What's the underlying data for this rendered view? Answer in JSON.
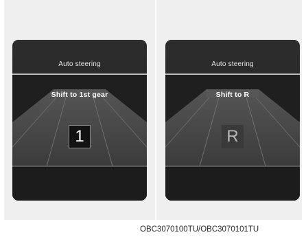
{
  "left_display": {
    "title": "Auto steering",
    "message": "Shift to 1st gear",
    "gear": "1"
  },
  "right_display": {
    "title": "Auto steering",
    "message": "Shift to R",
    "gear": "R"
  },
  "caption": "OBC3070100TU/OBC3070101TU",
  "colors": {
    "screen_bg": "#1f1f1f",
    "road": "#4a4a4a",
    "divider": "#bdbdbd"
  }
}
